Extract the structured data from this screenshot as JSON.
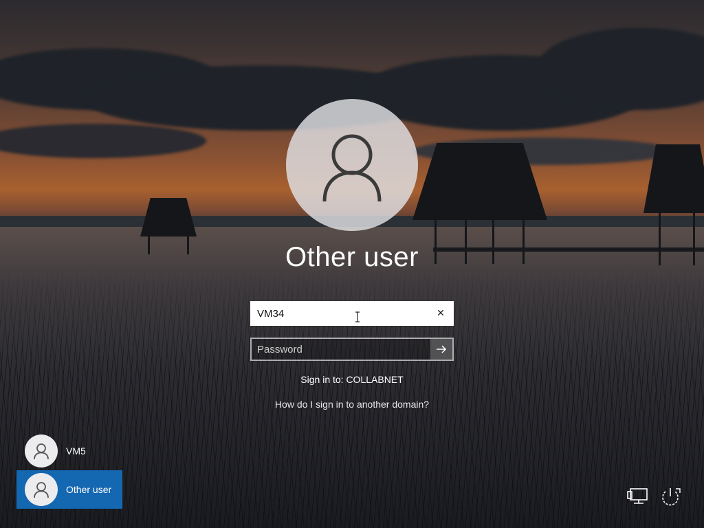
{
  "login": {
    "display_name": "Other user",
    "username_value": "VM34",
    "password_placeholder": "Password",
    "signin_to": "Sign in to: COLLABNET",
    "other_domain_link": "How do I sign in to another domain?"
  },
  "user_list": [
    {
      "label": "VM5",
      "selected": false
    },
    {
      "label": "Other user",
      "selected": true
    }
  ],
  "corner_icons": [
    "network-icon",
    "power-icon"
  ],
  "colors": {
    "selected_tile": "#1467b1",
    "text": "#ffffff"
  }
}
